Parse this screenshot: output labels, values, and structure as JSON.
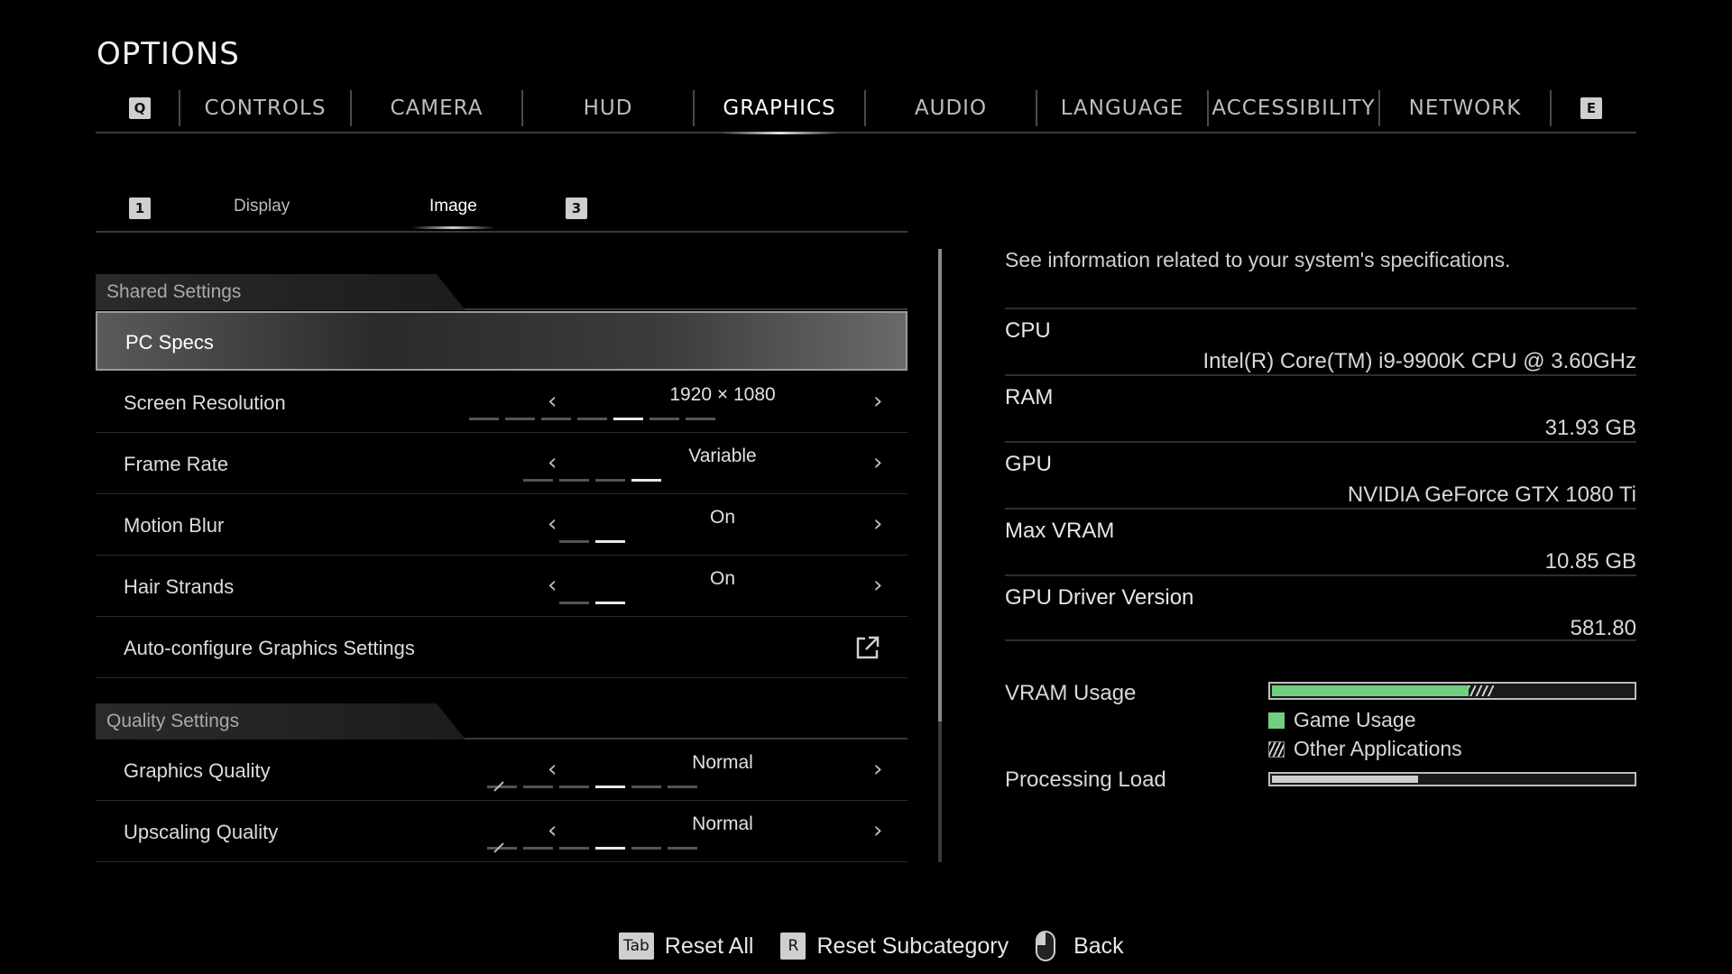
{
  "title": "OPTIONS",
  "top_nav": {
    "left_key": "Q",
    "right_key": "E",
    "tabs": [
      "CONTROLS",
      "CAMERA",
      "HUD",
      "GRAPHICS",
      "AUDIO",
      "LANGUAGE",
      "ACCESSIBILITY",
      "NETWORK"
    ],
    "active": "GRAPHICS"
  },
  "sub_nav": {
    "left_key": "1",
    "right_key": "3",
    "tabs": [
      "Display",
      "Image"
    ],
    "active": "Image"
  },
  "shared_settings": {
    "header": "Shared Settings",
    "rows": [
      {
        "label": "PC Specs",
        "selected": true
      },
      {
        "label": "Screen Resolution",
        "value": "1920 × 1080",
        "pip_count": 7,
        "pip_index": 4
      },
      {
        "label": "Frame Rate",
        "value": "Variable",
        "pip_count": 4,
        "pip_index": 3
      },
      {
        "label": "Motion Blur",
        "value": "On",
        "pip_count": 2,
        "pip_index": 1
      },
      {
        "label": "Hair Strands",
        "value": "On",
        "pip_count": 2,
        "pip_index": 1
      },
      {
        "label": "Auto-configure Graphics Settings",
        "icon": "external-link-icon"
      }
    ]
  },
  "quality_settings": {
    "header": "Quality Settings",
    "rows": [
      {
        "label": "Graphics Quality",
        "value": "Normal",
        "pip_count": 6,
        "pip_index": 3
      },
      {
        "label": "Upscaling Quality",
        "value": "Normal",
        "pip_count": 6,
        "pip_index": 3
      }
    ]
  },
  "arrows": {
    "left": "‹",
    "right": "›"
  },
  "pc_specs": {
    "description": "See information related to your system's specifications.",
    "items": [
      {
        "key": "CPU",
        "value": "Intel(R) Core(TM) i9-9900K CPU @ 3.60GHz"
      },
      {
        "key": "RAM",
        "value": "31.93 GB"
      },
      {
        "key": "GPU",
        "value": "NVIDIA GeForce GTX 1080 Ti"
      },
      {
        "key": "Max VRAM",
        "value": "10.85 GB"
      },
      {
        "key": "GPU Driver Version",
        "value": "581.80"
      }
    ],
    "vram_usage": {
      "label": "VRAM Usage",
      "game_usage_fraction": 0.54,
      "other_apps_fraction": 0.07,
      "legend_game": "Game Usage",
      "legend_other": "Other Applications",
      "game_color": "#6fcf7f"
    },
    "processing_load": {
      "label": "Processing Load",
      "fraction": 0.4,
      "color": "#cfcfcf"
    }
  },
  "footer": {
    "reset_all_key": "Tab",
    "reset_all": "Reset All",
    "reset_sub_key": "R",
    "reset_sub": "Reset Subcategory",
    "back": "Back"
  }
}
